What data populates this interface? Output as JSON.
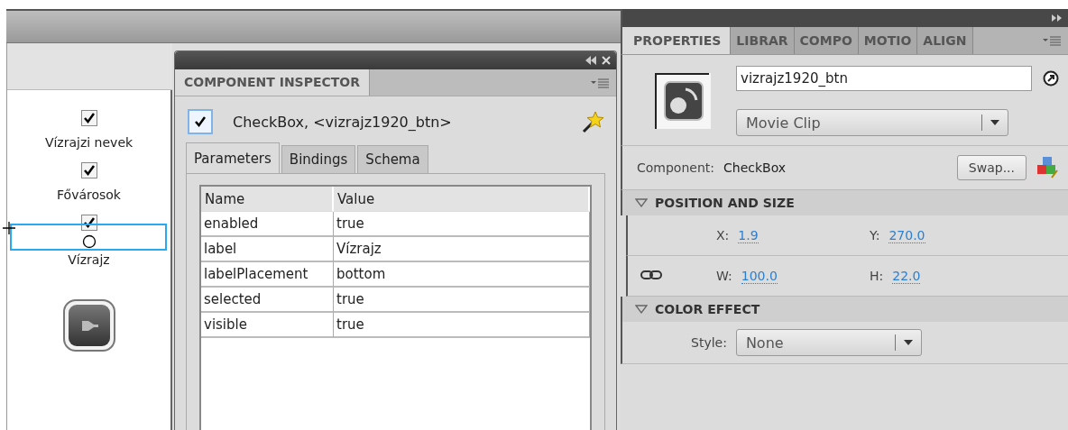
{
  "stage": {
    "checkboxes": [
      {
        "label": "Vízrajzi nevek",
        "checked": true,
        "selected": false
      },
      {
        "label": "Fővárosok",
        "checked": true,
        "selected": false
      },
      {
        "label": "Vízrajz",
        "checked": true,
        "selected": true
      }
    ]
  },
  "component_inspector": {
    "title": "COMPONENT INSPECTOR",
    "component": {
      "checked": true,
      "name": "CheckBox, <vizrajz1920_btn>"
    },
    "tabs": [
      {
        "label": "Parameters",
        "selected": true
      },
      {
        "label": "Bindings",
        "selected": false
      },
      {
        "label": "Schema",
        "selected": false
      }
    ],
    "table": {
      "columns": [
        "Name",
        "Value"
      ],
      "rows": [
        [
          "enabled",
          "true"
        ],
        [
          "label",
          "Vízrajz"
        ],
        [
          "labelPlacement",
          "bottom"
        ],
        [
          "selected",
          "true"
        ],
        [
          "visible",
          "true"
        ]
      ]
    }
  },
  "properties": {
    "tabs": [
      {
        "label": "PROPERTIES",
        "selected": true
      },
      {
        "label": "LIBRAR",
        "selected": false
      },
      {
        "label": "COMPO",
        "selected": false
      },
      {
        "label": "MOTIO",
        "selected": false
      },
      {
        "label": "ALIGN",
        "selected": false
      }
    ],
    "instance_name": "vizrajz1920_btn",
    "symbol_type": "Movie Clip",
    "component_label": "Component:",
    "component_value": "CheckBox",
    "swap_button": "Swap...",
    "sections": [
      {
        "title": "POSITION AND SIZE",
        "expanded": true,
        "kind": "fields",
        "rows": [
          [
            {
              "label": "X:",
              "value": "1.9"
            },
            {
              "label": "Y:",
              "value": "270.0"
            }
          ],
          [
            {
              "label": "W:",
              "value": "100.0"
            },
            {
              "label": "H:",
              "value": "22.0"
            }
          ]
        ]
      },
      {
        "title": "COLOR EFFECT",
        "expanded": true,
        "kind": "dropdown",
        "label": "Style:",
        "value": "None"
      }
    ]
  }
}
